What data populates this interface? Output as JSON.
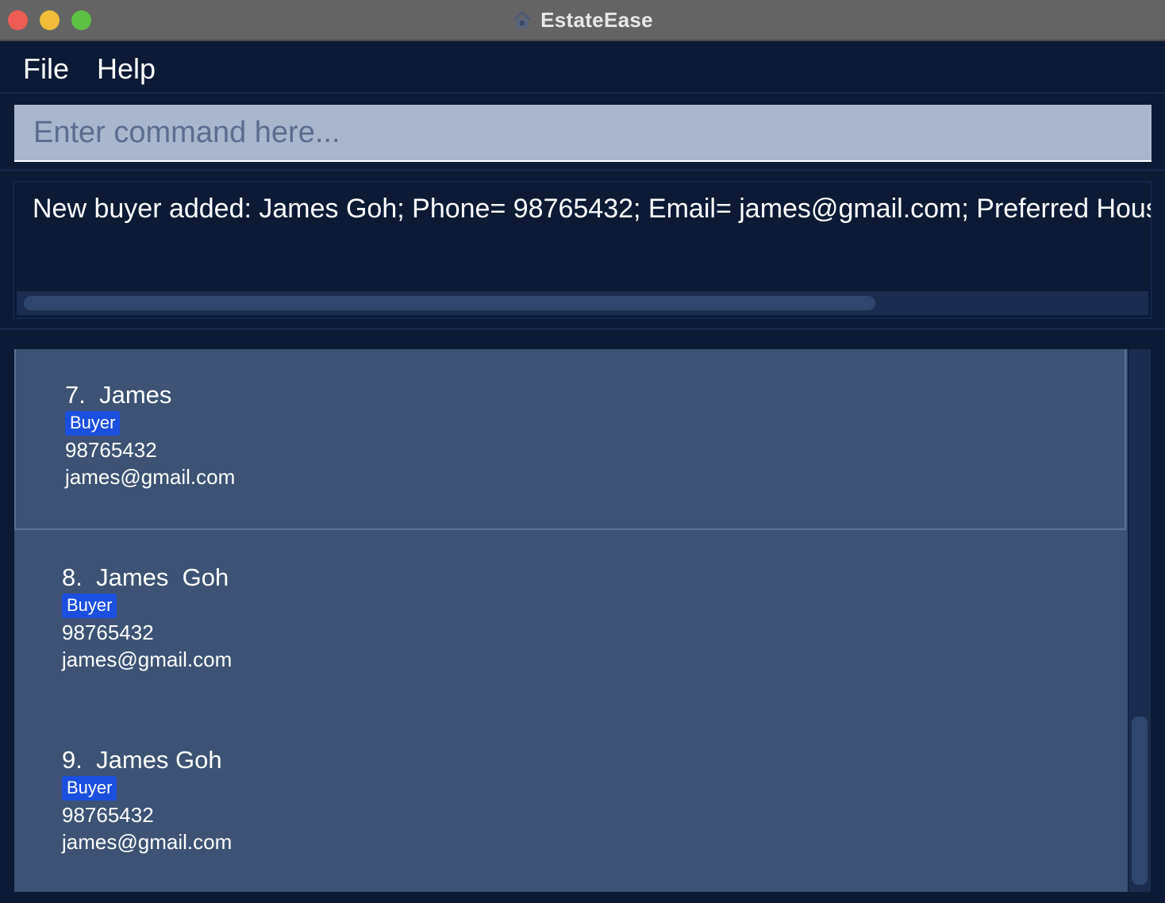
{
  "window": {
    "title": "EstateEase",
    "icon": "house-icon",
    "controls": [
      "close",
      "minimize",
      "maximize"
    ]
  },
  "menu": {
    "file_label": "File",
    "help_label": "Help"
  },
  "command": {
    "placeholder": "Enter command here...",
    "value": ""
  },
  "result": {
    "text": "New buyer added: James  Goh; Phone= 98765432; Email= james@gmail.com; Preferred Housing"
  },
  "persons": [
    {
      "index_name": "7.  James",
      "tag": "Buyer",
      "phone": "98765432",
      "email": "james@gmail.com"
    },
    {
      "index_name": "8.  James  Goh",
      "tag": "Buyer",
      "phone": "98765432",
      "email": "james@gmail.com"
    },
    {
      "index_name": "9.  James Goh",
      "tag": "Buyer",
      "phone": "98765432",
      "email": "james@gmail.com"
    }
  ],
  "colors": {
    "background": "#0c1a36",
    "card": "#3d5275",
    "tag": "#1b4fe0",
    "command_box": "#a9b6cc",
    "titlebar": "#646464"
  }
}
